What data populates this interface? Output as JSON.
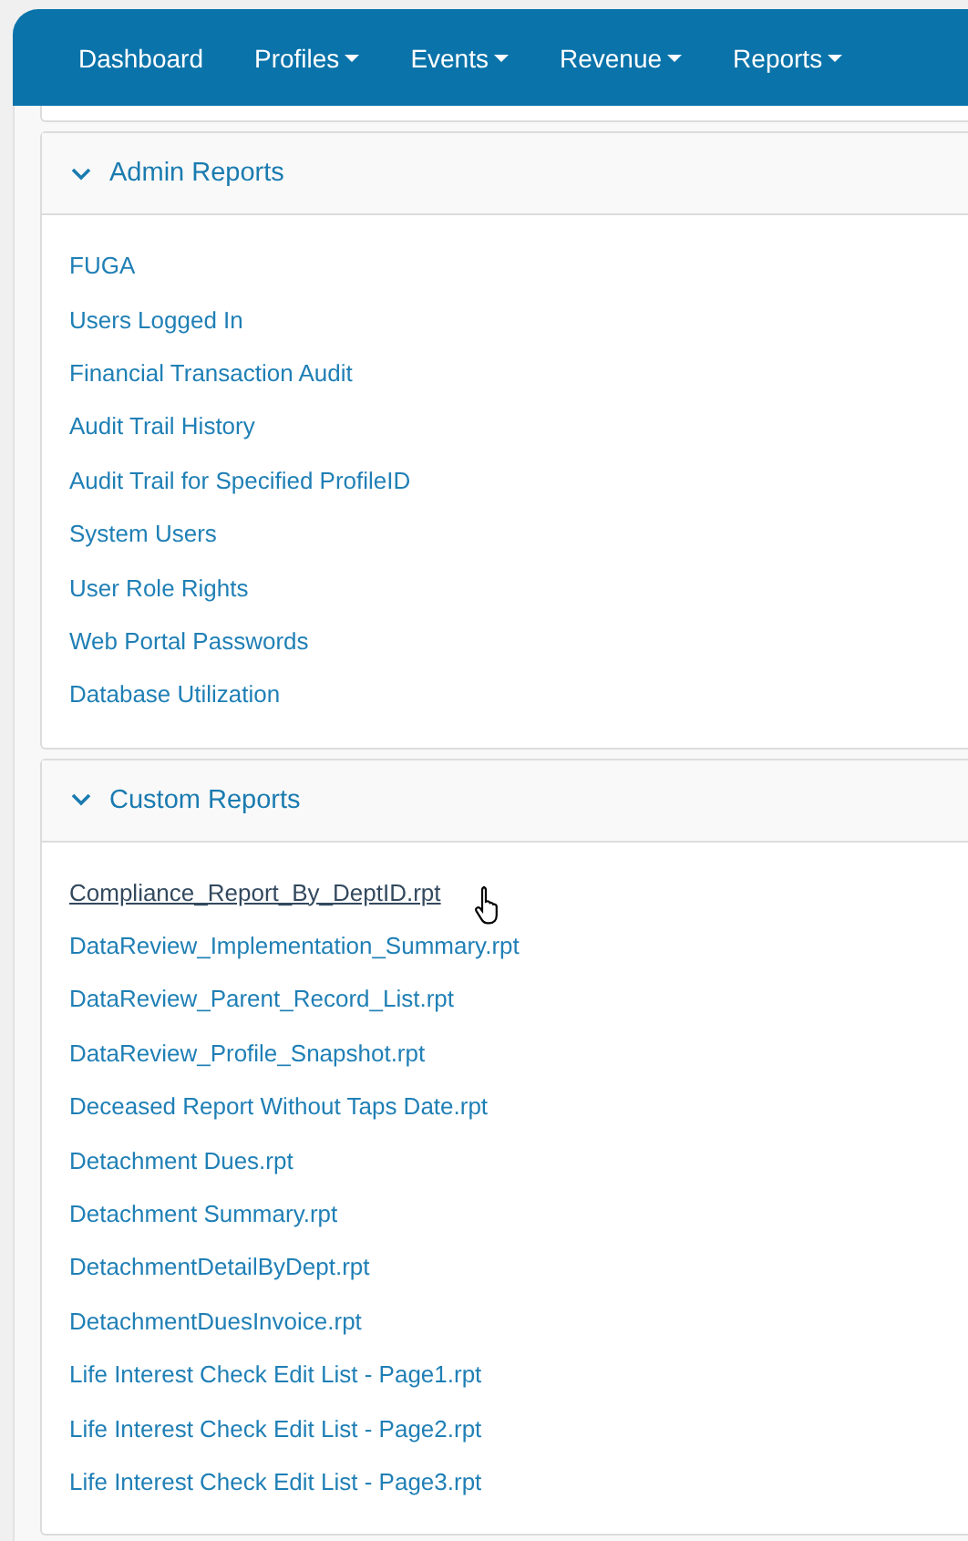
{
  "nav": [
    {
      "label": "Dashboard",
      "dropdown": false
    },
    {
      "label": "Profiles",
      "dropdown": true
    },
    {
      "label": "Events",
      "dropdown": true
    },
    {
      "label": "Revenue",
      "dropdown": true
    },
    {
      "label": "Reports",
      "dropdown": true
    }
  ],
  "sections": [
    {
      "title": "Admin Reports",
      "expanded": true,
      "items": [
        {
          "label": "FUGA",
          "hovered": false
        },
        {
          "label": "Users Logged In",
          "hovered": false
        },
        {
          "label": "Financial Transaction Audit",
          "hovered": false
        },
        {
          "label": "Audit Trail History",
          "hovered": false
        },
        {
          "label": "Audit Trail for Specified ProfileID",
          "hovered": false
        },
        {
          "label": "System Users",
          "hovered": false
        },
        {
          "label": "User Role Rights",
          "hovered": false
        },
        {
          "label": "Web Portal Passwords",
          "hovered": false
        },
        {
          "label": "Database Utilization",
          "hovered": false
        }
      ]
    },
    {
      "title": "Custom Reports",
      "expanded": true,
      "items": [
        {
          "label": "Compliance_Report_By_DeptID.rpt",
          "hovered": true
        },
        {
          "label": "DataReview_Implementation_Summary.rpt",
          "hovered": false
        },
        {
          "label": "DataReview_Parent_Record_List.rpt",
          "hovered": false
        },
        {
          "label": "DataReview_Profile_Snapshot.rpt",
          "hovered": false
        },
        {
          "label": "Deceased Report Without Taps Date.rpt",
          "hovered": false
        },
        {
          "label": "Detachment Dues.rpt",
          "hovered": false
        },
        {
          "label": "Detachment Summary.rpt",
          "hovered": false
        },
        {
          "label": "DetachmentDetailByDept.rpt",
          "hovered": false
        },
        {
          "label": "DetachmentDuesInvoice.rpt",
          "hovered": false
        },
        {
          "label": "Life Interest Check Edit List - Page1.rpt",
          "hovered": false
        },
        {
          "label": "Life Interest Check Edit List - Page2.rpt",
          "hovered": false
        },
        {
          "label": "Life Interest Check Edit List - Page3.rpt",
          "hovered": false
        }
      ]
    }
  ]
}
